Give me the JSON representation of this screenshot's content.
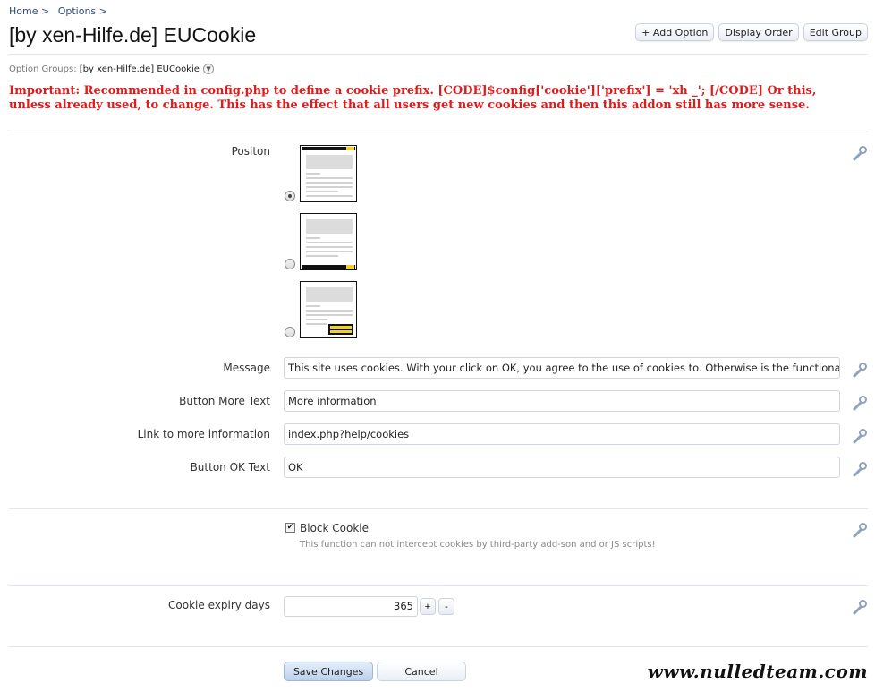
{
  "breadcrumb": [
    {
      "label": "Home >"
    },
    {
      "label": "Options >"
    }
  ],
  "page": {
    "title": "[by xen-Hilfe.de] EUCookie"
  },
  "toolbar": {
    "add_option": "+ Add Option",
    "display_order": "Display Order",
    "edit_group": "Edit Group"
  },
  "option_groups": {
    "label": "Option Groups:",
    "value": "[by xen-Hilfe.de] EUCookie"
  },
  "important_notice": "Important: Recommended in config.php to define a cookie prefix. [CODE]$config['cookie']['prefix'] = 'xh _'; [/CODE] Or this, unless already used, to change. This has the effect that all users get new cookies and then this addon still has more sense.",
  "options": {
    "position": {
      "label": "Positon",
      "choices": [
        {
          "name": "top",
          "selected": true
        },
        {
          "name": "bottom",
          "selected": false
        },
        {
          "name": "bottom-right",
          "selected": false
        }
      ]
    },
    "message": {
      "label": "Message",
      "value": "This site uses cookies. With your click on OK, you agree to the use of cookies to. Otherwise is the functionality of this"
    },
    "button_more_text": {
      "label": "Button More Text",
      "value": "More information"
    },
    "link_more_info": {
      "label": "Link to more information",
      "value": "index.php?help/cookies"
    },
    "button_ok_text": {
      "label": "Button OK Text",
      "value": "OK"
    },
    "block_cookie": {
      "label": "Block Cookie",
      "checked": true,
      "hint": "This function can not intercept cookies by third-party add-son and or JS scripts!"
    },
    "cookie_expiry": {
      "label": "Cookie expiry days",
      "value": "365",
      "plus": "+",
      "minus": "-"
    }
  },
  "footer": {
    "save": "Save Changes",
    "cancel": "Cancel"
  },
  "watermark": "www.nulledteam.com",
  "colors": {
    "notice": "#e01b1b",
    "link": "#2b4a7a",
    "highlight_yellow": "#f2d21c"
  },
  "icons": {
    "edit": "wrench-icon",
    "dropdown": "chevron-down-icon"
  }
}
